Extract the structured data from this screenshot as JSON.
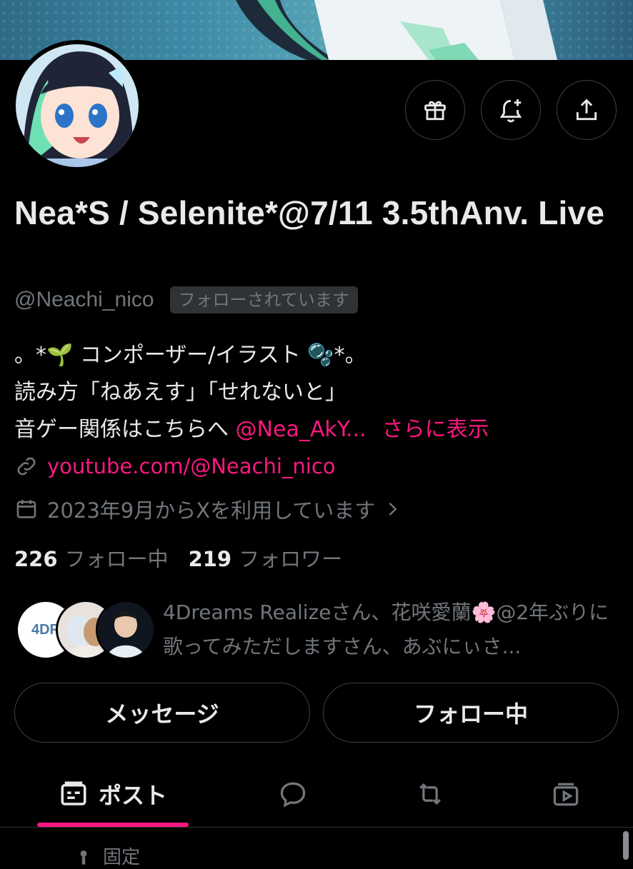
{
  "profile": {
    "display_name": "Nea*S / Selenite*@7/11 3.5thAnv. Live",
    "handle": "@Neachi_nico",
    "follows_you_badge": "フォローされています",
    "bio_line1": "。*🌱 コンポーザー/イラスト 🫧*。",
    "bio_line2": "読み方「ねあえす」「せれないと」",
    "bio_line3_text": "音ゲー関係はこちらへ ",
    "bio_line3_mention": "@Nea_AkY...",
    "bio_more": "さらに表示",
    "website": "youtube.com/@Neachi_nico",
    "joined": "2023年9月からXを利用しています"
  },
  "stats": {
    "following_count": "226",
    "following_label": "フォロー中",
    "followers_count": "219",
    "followers_label": "フォロワー"
  },
  "mutuals": {
    "text": "4Dreams Realizeさん、花咲愛蘭🌸@2年ぶりに歌ってみただしますさん、あぶにぃさ...",
    "first_avatar_text": "4DR"
  },
  "actions": {
    "message_label": "メッセージ",
    "following_label": "フォロー中"
  },
  "tabs": {
    "posts_label": "ポスト"
  },
  "pinned_label": "固定",
  "colors": {
    "accent_pink": "#f91880",
    "muted_text": "#71767b",
    "border": "#3e4144",
    "background": "#000000"
  },
  "icons": [
    "gift-icon",
    "notification-add-icon",
    "share-icon",
    "link-icon",
    "calendar-icon",
    "chevron-right-icon",
    "posts-icon",
    "reply-icon",
    "repost-icon",
    "media-icon",
    "pin-icon"
  ]
}
